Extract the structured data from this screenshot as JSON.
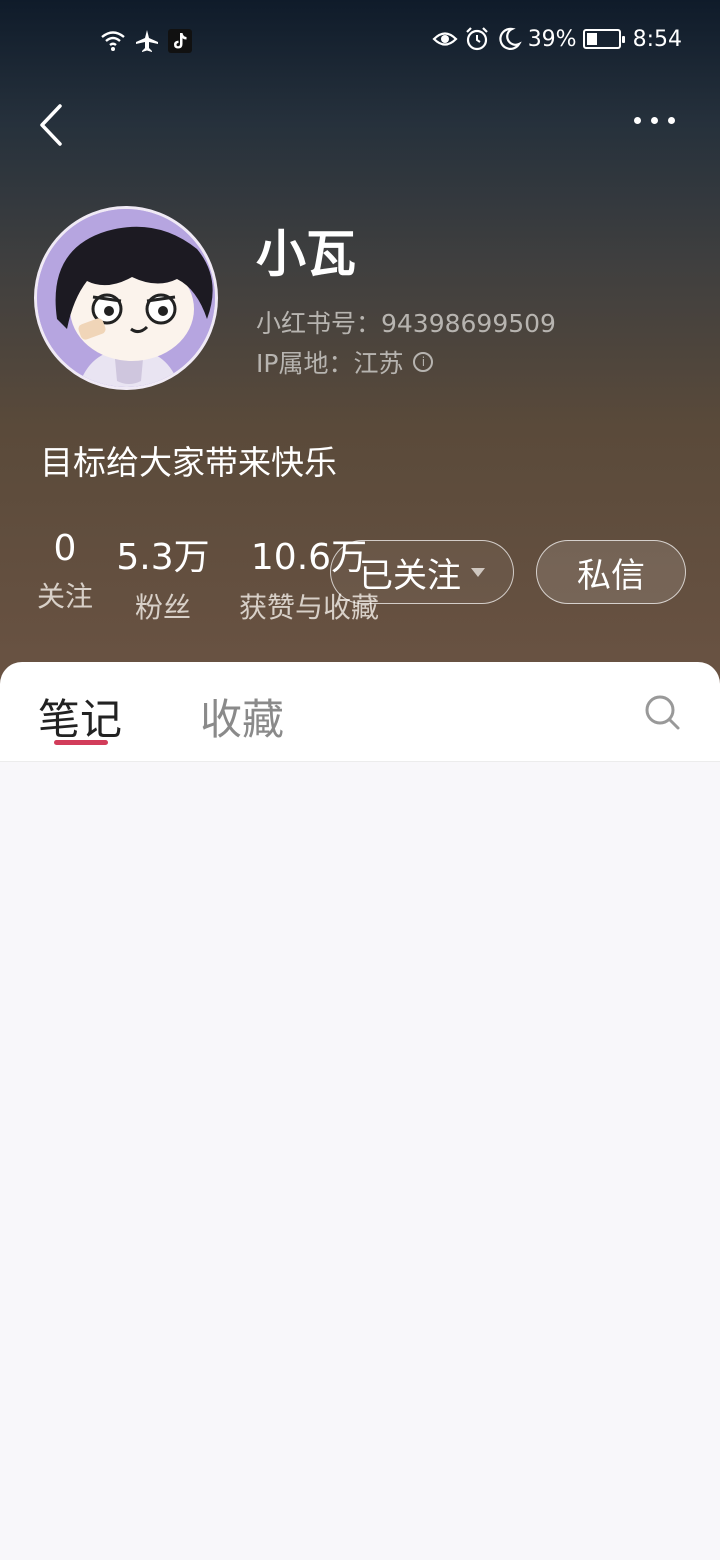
{
  "status_bar": {
    "battery": "39%",
    "time": "8:54"
  },
  "profile": {
    "name": "小瓦",
    "red_id": "小红书号：94398699509",
    "ip_location": "IP属地：江苏",
    "bio": "目标给大家带来快乐"
  },
  "stats": {
    "following": {
      "value": "0",
      "label": "关注"
    },
    "fans": {
      "value": "5.3万",
      "label": "粉丝"
    },
    "likes_collects": {
      "value": "10.6万",
      "label": "获赞与收藏"
    }
  },
  "actions": {
    "follow_label": "已关注",
    "message_label": "私信"
  },
  "tabs": [
    {
      "label": "笔记",
      "active": true
    },
    {
      "label": "收藏",
      "active": false
    }
  ],
  "colors": {
    "accent": "#d23c5a"
  }
}
